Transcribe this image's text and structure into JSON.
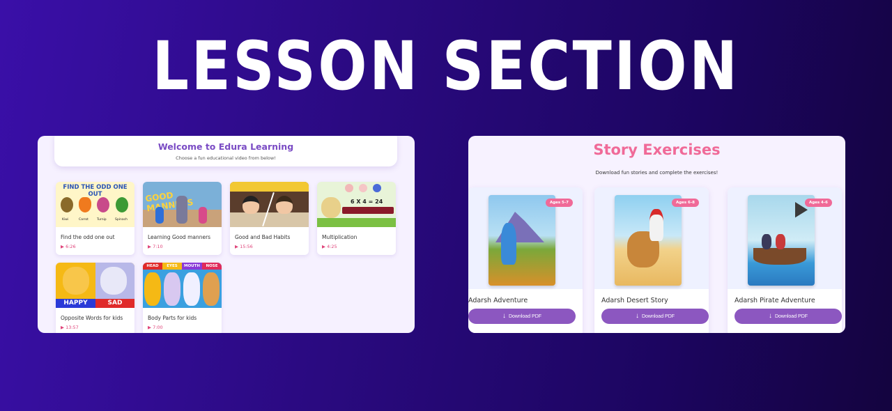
{
  "hero": {
    "title": "LESSON SECTION"
  },
  "lessons": {
    "welcome_title": "Welcome to Edura Learning",
    "welcome_subtitle": "Choose a fun educational video from below!",
    "thumb1_header": "FIND THE ODD ONE OUT",
    "thumb1_items": [
      "Kiwi",
      "Carrot",
      "Turnip",
      "Spinach"
    ],
    "thumb2_text": "GOOD MANNERS",
    "thumb4_text": "6 X 4 = 24",
    "thumb5_labels": [
      "HAPPY",
      "SAD"
    ],
    "thumb6_labels": [
      "HEAD",
      "EYES",
      "MOUTH",
      "NOSE"
    ],
    "videos": [
      {
        "title": "Find the odd one out",
        "duration": "▶ 6:26"
      },
      {
        "title": "Learning Good manners",
        "duration": "▶ 7:10"
      },
      {
        "title": "Good and Bad Habits",
        "duration": "▶ 15:56"
      },
      {
        "title": "Multiplication",
        "duration": "▶ 4:25"
      },
      {
        "title": "Opposite Words for kids",
        "duration": "▶ 13:57"
      },
      {
        "title": "Body Parts for kids",
        "duration": "▶ 7:00"
      }
    ]
  },
  "stories": {
    "title": "Story Exercises",
    "subtitle": "Download fun stories and complete the exercises!",
    "download_label": "Download PDF",
    "items": [
      {
        "title": "Adarsh Adventure",
        "age": "Ages 5-7"
      },
      {
        "title": "Adarsh Desert Story",
        "age": "Ages 6-8"
      },
      {
        "title": "Adarsh Pirate Adventure",
        "age": "Ages 4-6"
      }
    ]
  },
  "colors": {
    "accent": "#8c57c0",
    "pink": "#f06a98",
    "background": "#2a0a80"
  }
}
